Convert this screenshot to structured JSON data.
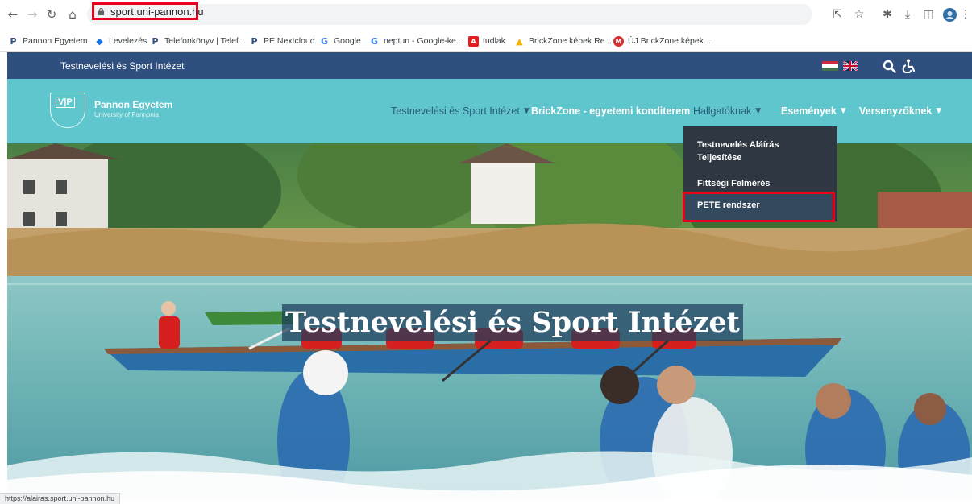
{
  "browser": {
    "url": "sport.uni-pannon.hu",
    "status_url": "https://alairas.sport.uni-pannon.hu"
  },
  "bookmarks": [
    {
      "label": "Pannon Egyetem",
      "icon": "pannon-p-icon",
      "color": "#2f4f7f"
    },
    {
      "label": "Levelezés",
      "icon": "mail-icon",
      "color": "#1a73e8"
    },
    {
      "label": "Telefonkönyv | Telef...",
      "icon": "pannon-p-icon",
      "color": "#2f4f7f"
    },
    {
      "label": "PE Nextcloud",
      "icon": "pannon-p-icon",
      "color": "#2f4f7f"
    },
    {
      "label": "Google",
      "icon": "google-icon",
      "color": "#4285f4"
    },
    {
      "label": "neptun - Google-ke...",
      "icon": "google-icon",
      "color": "#4285f4"
    },
    {
      "label": "tudlak",
      "icon": "pdf-icon",
      "color": "#e02020"
    },
    {
      "label": "BrickZone képek Re...",
      "icon": "drive-icon",
      "color": "#f4b400"
    },
    {
      "label": "ÚJ BrickZone képek...",
      "icon": "m-icon",
      "color": "#d32f2f"
    }
  ],
  "site": {
    "topbar_title": "Testnevelési és Sport Intézet",
    "logo_name": "Pannon Egyetem",
    "logo_sub": "University of Pannonia",
    "logo_letters": "V|P",
    "menu": [
      {
        "label": "Testnevelési és Sport Intézet",
        "has_chevron": true
      },
      {
        "label": "BrickZone - egyetemi konditerem",
        "has_chevron": false
      },
      {
        "label": "Hallgatóknak",
        "has_chevron": true
      },
      {
        "label": "Események",
        "has_chevron": true
      },
      {
        "label": "Versenyzőknek",
        "has_chevron": true
      }
    ],
    "dropdown": [
      "Testnevelés Aláírás Teljesítése",
      "Fittségi Felmérés",
      "PETE rendszer"
    ],
    "hero_title": "Testnevelési és Sport Intézet"
  },
  "colors": {
    "topbar": "#2f4f7f",
    "header": "#5ec6cc",
    "dropdown": "#2e3742",
    "highlight": "#e8001c"
  }
}
